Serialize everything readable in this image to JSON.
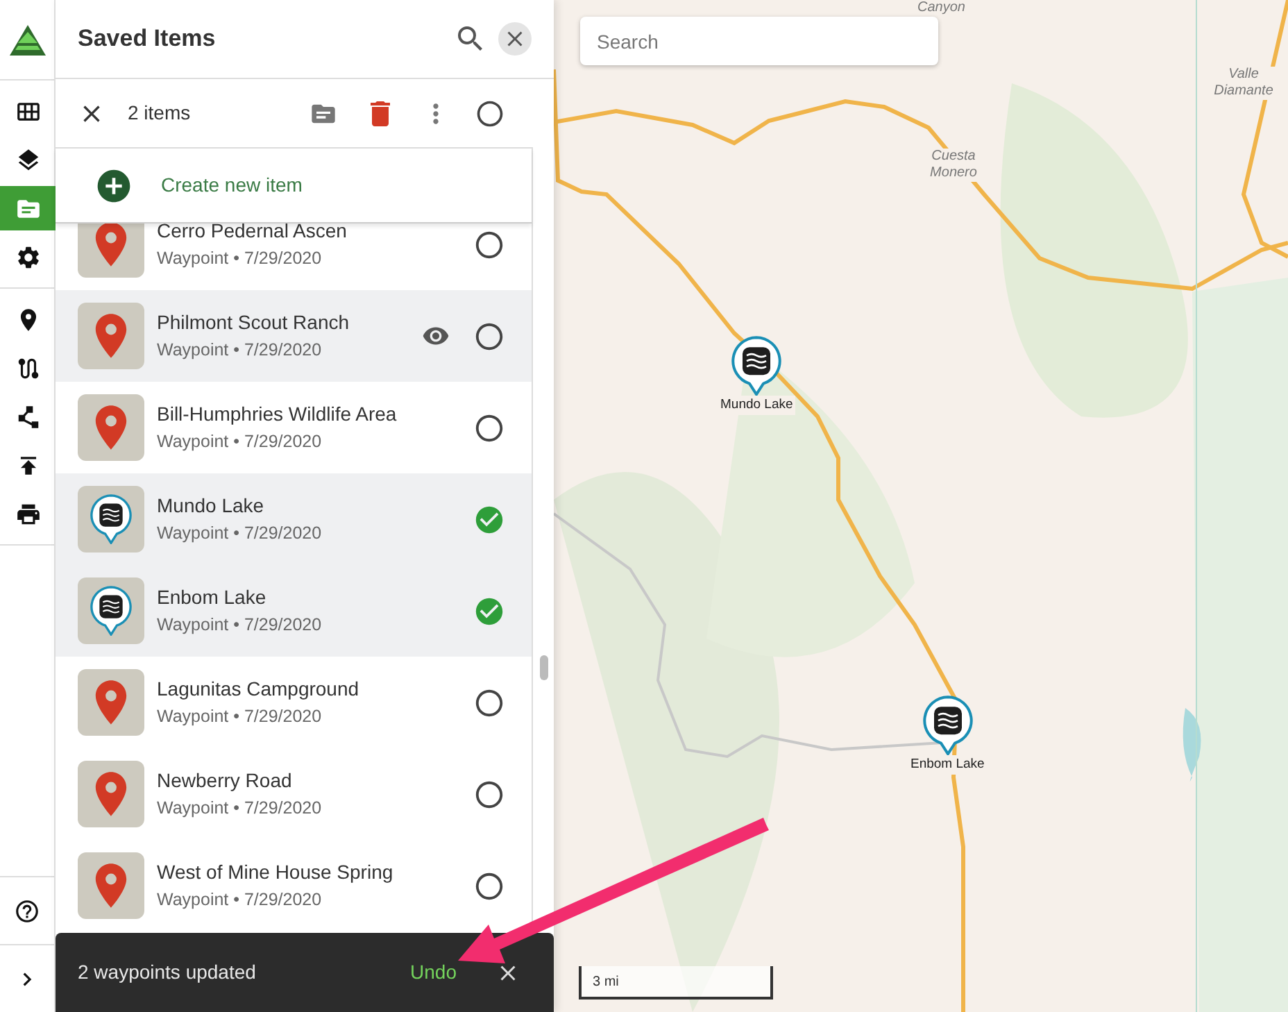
{
  "rail": {
    "groups": [
      {
        "items": [
          {
            "selected": false
          },
          {
            "selected": false
          },
          {
            "selected": true
          },
          {
            "selected": false
          }
        ]
      },
      {
        "items": [
          {
            "selected": false
          },
          {
            "selected": false
          },
          {
            "selected": false
          },
          {
            "selected": false
          },
          {
            "selected": false
          }
        ]
      }
    ]
  },
  "panel": {
    "title": "Saved Items",
    "toolbar": {
      "count": "2 items",
      "all_selected": false
    },
    "create": "Create new item",
    "items": [
      {
        "name": "Cerro Pedernal Ascen",
        "subtitle": "Waypoint • 7/29/2020",
        "kind": "pin",
        "checked": false,
        "hovered": false
      },
      {
        "name": "Philmont Scout Ranch",
        "subtitle": "Waypoint • 7/29/2020",
        "kind": "pin",
        "checked": false,
        "hovered": true
      },
      {
        "name": "Bill-Humphries Wildlife Area",
        "subtitle": "Waypoint • 7/29/2020",
        "kind": "pin",
        "checked": false,
        "hovered": false
      },
      {
        "name": "Mundo Lake",
        "subtitle": "Waypoint • 7/29/2020",
        "kind": "lake",
        "checked": true,
        "hovered": false
      },
      {
        "name": "Enbom Lake",
        "subtitle": "Waypoint • 7/29/2020",
        "kind": "lake",
        "checked": true,
        "hovered": false
      },
      {
        "name": "Lagunitas Campground",
        "subtitle": "Waypoint • 7/29/2020",
        "kind": "pin",
        "checked": false,
        "hovered": false
      },
      {
        "name": "Newberry Road",
        "subtitle": "Waypoint • 7/29/2020",
        "kind": "pin",
        "checked": false,
        "hovered": false
      },
      {
        "name": "West of Mine House Spring",
        "subtitle": "Waypoint • 7/29/2020",
        "kind": "pin",
        "checked": false,
        "hovered": false
      }
    ]
  },
  "toast": {
    "message": "2 waypoints updated",
    "action": "Undo"
  },
  "map": {
    "search": {
      "placeholder": "Search"
    },
    "labels": [
      "Canyon",
      "Cuesta Monero",
      "Valle Diamante"
    ],
    "markers": [
      {
        "name": "Mundo Lake"
      },
      {
        "name": "Enbom Lake"
      }
    ],
    "scale": "3 mi"
  }
}
